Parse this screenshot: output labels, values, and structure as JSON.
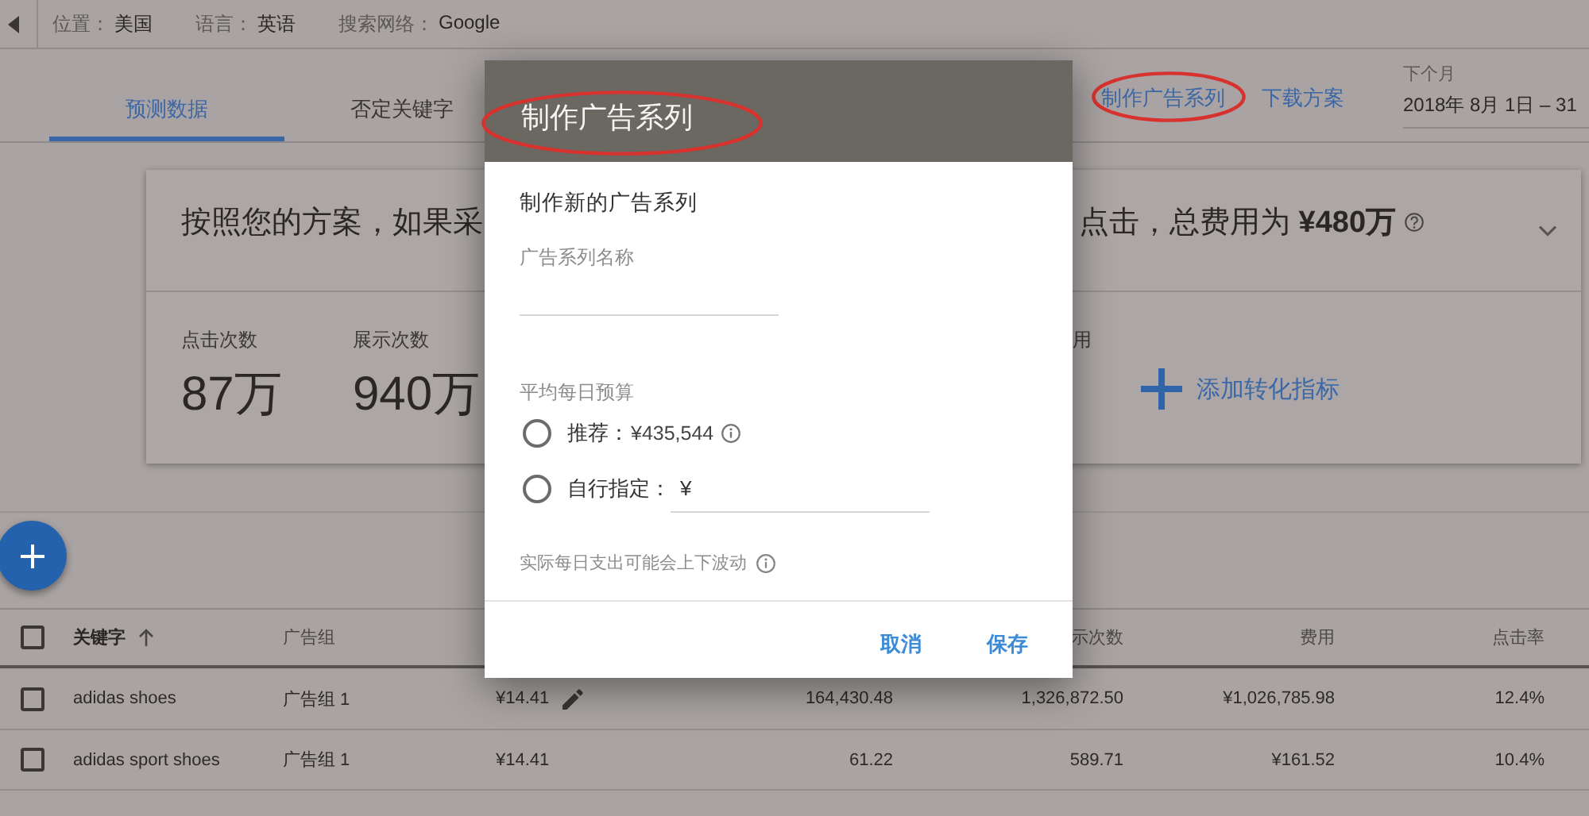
{
  "top_bar": {
    "filters": [
      {
        "label": "位置：",
        "value": "美国"
      },
      {
        "label": "语言：",
        "value": "英语"
      },
      {
        "label": "搜索网络：",
        "value": "Google"
      }
    ]
  },
  "tabs": [
    {
      "label": "预测数据",
      "selected": true
    },
    {
      "label": "否定关键字",
      "selected": false
    }
  ],
  "actions": [
    {
      "label": "制作广告系列",
      "circled": true
    },
    {
      "label": "下载方案",
      "circled": false
    }
  ],
  "date_range": {
    "label": "下个月",
    "value": "2018年 8月 1日 – 31"
  },
  "summary": {
    "headline_start": "按照您的方案，如果采",
    "headline_end": "点击，总费用为 **¥480万**",
    "metrics": [
      {
        "label": "点击次数",
        "value": "87万"
      },
      {
        "label": "展示次数",
        "value": "940万"
      },
      {
        "label": "用"
      }
    ],
    "add_metric": "添加转化指标"
  },
  "table": {
    "select_all_checked": false,
    "columns": [
      {
        "label": "关键字",
        "sorted": true
      },
      {
        "label": "广告组"
      },
      {},
      {},
      {
        "label": "示次数"
      },
      {
        "label": "费用"
      },
      {
        "label": "点击率"
      }
    ],
    "rows": [
      {
        "checked": false,
        "edit_icon": true,
        "cells": [
          "adidas shoes",
          "广告组 1",
          "¥14.41",
          "164,430.48",
          "1,326,872.50",
          "¥1,026,785.98",
          "12.4%"
        ]
      },
      {
        "checked": false,
        "edit_icon": false,
        "cells": [
          "adidas sport shoes",
          "广告组 1",
          "¥14.41",
          "61.22",
          "589.71",
          "¥161.52",
          "10.4%"
        ]
      }
    ]
  },
  "dialog": {
    "title": "制作广告系列",
    "circled": true,
    "subtitle": "制作新的广告系列",
    "name_label": "广告系列名称",
    "budget_label": "平均每日预算",
    "budget_options": [
      {
        "kind": "recommended",
        "label": "推荐：",
        "value": "¥435,544",
        "selected": false
      },
      {
        "kind": "custom",
        "label": "自行指定：",
        "prefix": "¥",
        "selected": false
      }
    ],
    "note": "实际每日支出可能会上下波动",
    "buttons": [
      {
        "label": "取消"
      },
      {
        "label": "保存"
      }
    ]
  }
}
